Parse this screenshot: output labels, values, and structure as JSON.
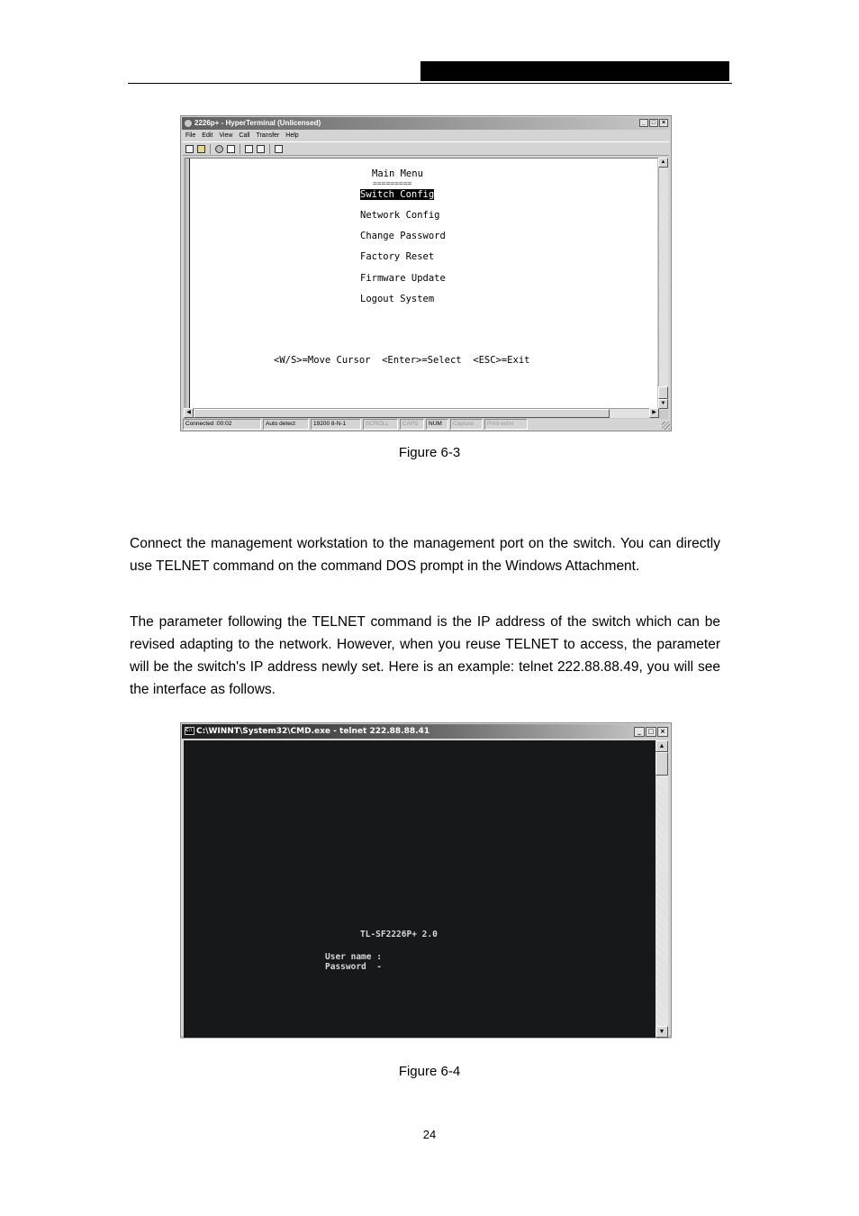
{
  "figure_6_3": {
    "window_title": "2226p+ - HyperTerminal (Unlicensed)",
    "window_buttons": [
      "_",
      "□",
      "×"
    ],
    "menu": [
      "File",
      "Edit",
      "View",
      "Call",
      "Transfer",
      "Help"
    ],
    "toolbar_icons": [
      "new-icon",
      "open-icon",
      "disconnect-icon",
      "dial-icon",
      "send-icon",
      "receive-icon",
      "properties-icon"
    ],
    "terminal": {
      "title": "Main Menu",
      "underline": "=========",
      "items": [
        {
          "label": "Switch Config",
          "selected": true
        },
        {
          "label": "Network Config",
          "selected": false
        },
        {
          "label": "Change Password",
          "selected": false
        },
        {
          "label": "Factory Reset",
          "selected": false
        },
        {
          "label": "Firmware Update",
          "selected": false
        },
        {
          "label": "Logout System",
          "selected": false
        }
      ],
      "help_line": "<W/S>=Move Cursor  <Enter>=Select  <ESC>=Exit"
    },
    "status": {
      "connected": "Connected :00:02",
      "detect": "Auto detect",
      "settings": "19200 8-N-1",
      "scroll": "SCROLL",
      "caps": "CAPS",
      "num": "NUM",
      "capture": "Capture",
      "print_echo": "Print echo"
    },
    "caption": "Figure 6-3"
  },
  "paragraphs": [
    "Connect the management workstation to the management port on the switch. You can directly use TELNET command on the command DOS prompt in the Windows Attachment.",
    "The parameter following the TELNET command is the IP address of the switch which can be revised adapting to the network. However, when you reuse TELNET to access, the parameter will be the switch's IP address newly set. Here is an example: telnet 222.88.88.49, you will see the interface as follows."
  ],
  "figure_6_4": {
    "window_title": "C:\\WINNT\\System32\\CMD.exe - telnet 222.88.88.41",
    "icon_text": "C:\\",
    "window_buttons": [
      "_",
      "□",
      "×"
    ],
    "terminal": {
      "product": "TL-SF2226P+ 2.0",
      "user_label": "User name :",
      "password_label": "Password  -"
    },
    "caption": "Figure 6-4"
  },
  "page_number": "24"
}
